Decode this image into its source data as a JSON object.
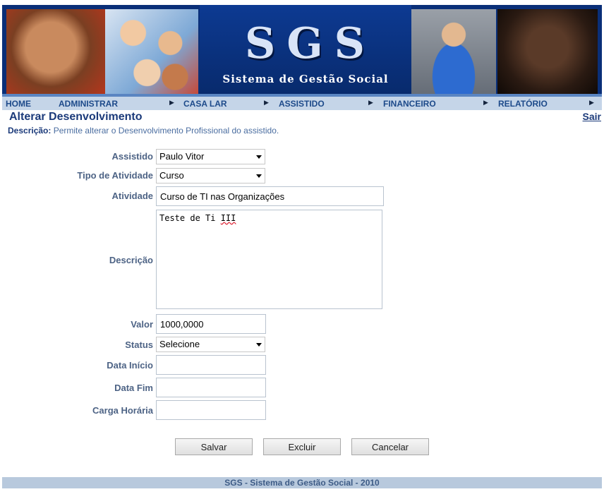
{
  "banner": {
    "logo_text": "SGS",
    "subtitle": "Sistema de Gestão Social"
  },
  "nav": {
    "items": [
      {
        "label": "HOME"
      },
      {
        "label": "ADMINISTRAR"
      },
      {
        "label": "CASA LAR"
      },
      {
        "label": "ASSISTIDO"
      },
      {
        "label": "FINANCEIRO"
      },
      {
        "label": "RELATÓRIO"
      }
    ]
  },
  "header": {
    "title": "Alterar Desenvolvimento",
    "logout_label": "Sair",
    "description_label": "Descrição:",
    "description_text": "Permite alterar o Desenvolvimento Profissional do assistido."
  },
  "form": {
    "assistido": {
      "label": "Assistido",
      "value": "Paulo Vitor"
    },
    "tipo_atividade": {
      "label": "Tipo de Atividade",
      "value": "Curso"
    },
    "atividade": {
      "label": "Atividade",
      "value": "Curso de TI nas Organizações"
    },
    "descricao": {
      "label": "Descrição",
      "value_main": "Teste de Ti ",
      "value_flagged": "III"
    },
    "valor": {
      "label": "Valor",
      "value": "1000,0000"
    },
    "status": {
      "label": "Status",
      "value": "Selecione"
    },
    "data_inicio": {
      "label": "Data Início",
      "value": ""
    },
    "data_fim": {
      "label": "Data Fim",
      "value": ""
    },
    "carga_horaria": {
      "label": "Carga Horária",
      "value": ""
    }
  },
  "buttons": {
    "save": "Salvar",
    "delete": "Excluir",
    "cancel": "Cancelar"
  },
  "footer": {
    "text": "SGS - Sistema de Gestão Social - 2010"
  }
}
